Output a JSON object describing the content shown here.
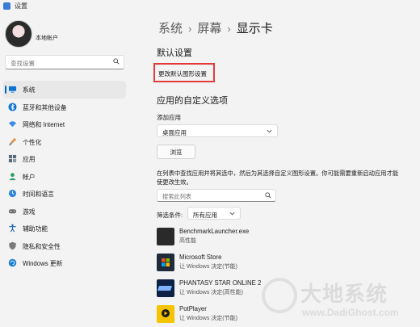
{
  "window": {
    "title": "设置"
  },
  "user": {
    "name": "本地帐户"
  },
  "sidebar": {
    "search_placeholder": "查找设置",
    "items": [
      {
        "label": "系统",
        "icon": "monitor-icon",
        "active": true
      },
      {
        "label": "蓝牙和其他设备",
        "icon": "bluetooth-icon"
      },
      {
        "label": "网络和 Internet",
        "icon": "wifi-icon"
      },
      {
        "label": "个性化",
        "icon": "brush-icon"
      },
      {
        "label": "应用",
        "icon": "apps-icon"
      },
      {
        "label": "帐户",
        "icon": "person-icon"
      },
      {
        "label": "时间和语言",
        "icon": "globe-clock-icon"
      },
      {
        "label": "游戏",
        "icon": "gamepad-icon"
      },
      {
        "label": "辅助功能",
        "icon": "accessibility-icon"
      },
      {
        "label": "隐私和安全性",
        "icon": "shield-icon"
      },
      {
        "label": "Windows 更新",
        "icon": "update-icon"
      }
    ]
  },
  "breadcrumb": {
    "part1": "系统",
    "part2": "屏幕",
    "current": "显示卡"
  },
  "default_settings": {
    "title": "默认设置",
    "link": "更改默认图形设置"
  },
  "custom_options": {
    "title": "应用的自定义选项",
    "add_app_label": "添加应用",
    "app_type_value": "桌面应用",
    "browse_label": "浏览",
    "help_text": "在列表中查找应用并将其选中，然后为其选择自定义图形设置。你可能需要重新启动应用才能使更改生效。",
    "list_search_placeholder": "搜索此列表",
    "filter_label": "筛选条件:",
    "filter_value": "所有应用"
  },
  "apps": [
    {
      "name": "BenchmarkLauncher.exe",
      "sub": "高性能",
      "icon": "benchmark-app-icon",
      "color": "#2a2a2a"
    },
    {
      "name": "Microsoft Store",
      "sub": "让 Windows 决定(节能)",
      "icon": "store-app-icon",
      "color": "#1f2a3a"
    },
    {
      "name": "PHANTASY STAR ONLINE 2",
      "sub": "让 Windows 决定(高性能)",
      "icon": "pso2-app-icon",
      "color": "#0d2244"
    },
    {
      "name": "PotPlayer",
      "sub": "让 Windows 决定(节能)",
      "icon": "potplayer-app-icon",
      "color": "#f5c400"
    }
  ],
  "watermark": {
    "title": "大地系统",
    "sub": "www.DadiGhost.com"
  },
  "colors": {
    "accent": "#0067c0",
    "highlight_border": "#e23a3a",
    "background": "#f3f3f3"
  }
}
